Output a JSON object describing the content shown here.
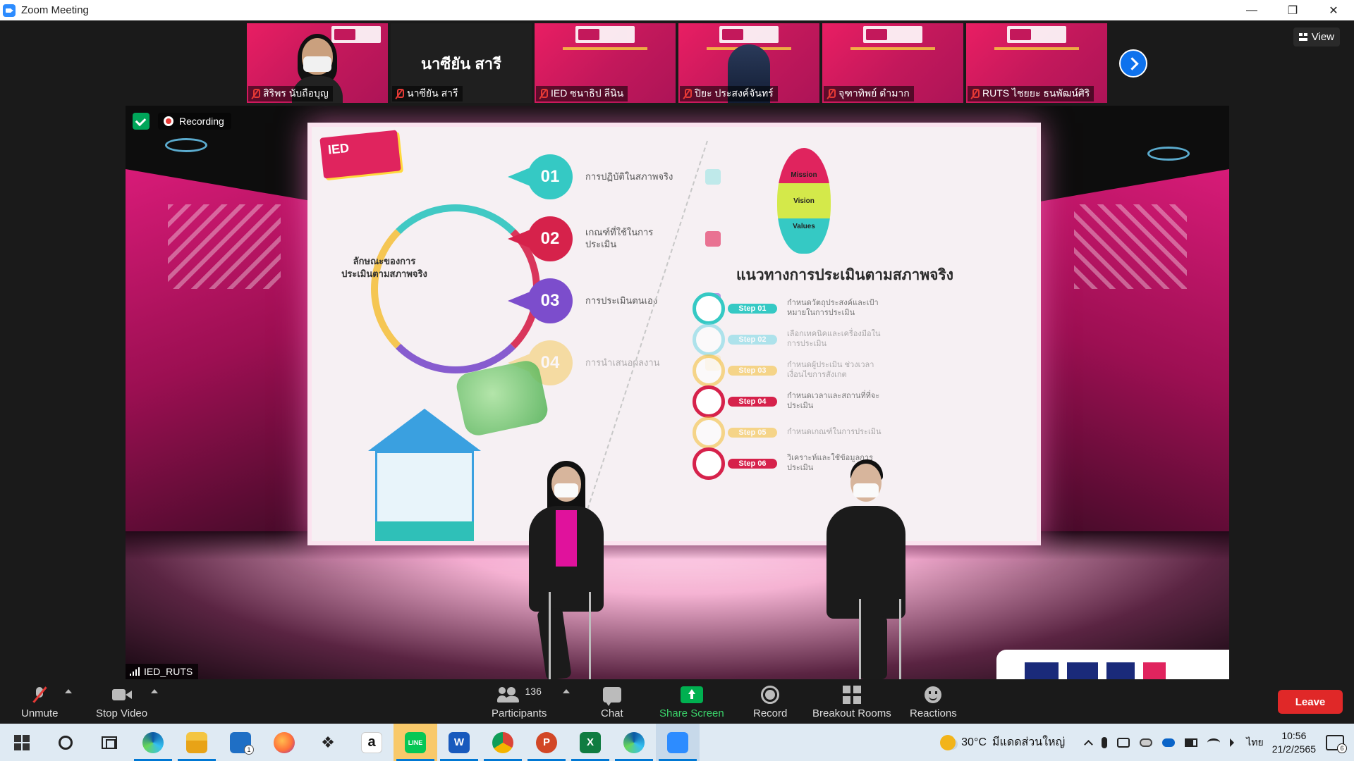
{
  "window": {
    "title": "Zoom Meeting",
    "minimize_glyph": "—",
    "restore_glyph": "❐",
    "close_glyph": "✕"
  },
  "gallery": {
    "tiles": [
      {
        "name": "สิริพร นับถือบุญ",
        "type": "camera"
      },
      {
        "name": "นาซียัน สารี",
        "type": "name-only",
        "display_name": "นาซียัน สารี"
      },
      {
        "name": "IED ซนาธิป ลีนิน",
        "type": "background"
      },
      {
        "name": "ปิยะ ประสงค์จันทร์",
        "type": "camera-dark"
      },
      {
        "name": "จุฑาทิพย์ ดำมาก",
        "type": "background"
      },
      {
        "name": "RUTS ไชยยะ ธนพัฒน์ศิริ",
        "type": "background"
      }
    ],
    "next_icon": "chevron-right-icon",
    "view_label": "View"
  },
  "video": {
    "recording_label": "Recording",
    "speaker_name": "IED_RUTS",
    "slide": {
      "logo_text": "IED",
      "steps": [
        {
          "num": "01",
          "color": "#35c9c4",
          "text": "การปฏิบัติในสภาพจริง"
        },
        {
          "num": "02",
          "color": "#d6224b",
          "text": "เกณฑ์ที่ใช้ในการประเมิน"
        },
        {
          "num": "03",
          "color": "#7c4dcc",
          "text": "การประเมินตนเอง"
        },
        {
          "num": "04",
          "color": "#f5c242",
          "text": "การนำเสนอผลงาน"
        }
      ],
      "center_text": "ลักษณะของการประเมินตามสภาพจริง",
      "balloon": [
        "Mission",
        "Vision",
        "Values"
      ],
      "heading": "แนวทางการประเมินตามสภาพจริง",
      "right_steps": [
        {
          "label": "Step 01",
          "color": "#35c9c4",
          "text": "กำหนดวัตถุประสงค์และเป้าหมายในการประเมิน"
        },
        {
          "label": "Step 02",
          "color": "#7ed9e6",
          "text": "เลือกเทคนิคและเครื่องมือในการประเมิน"
        },
        {
          "label": "Step 03",
          "color": "#f5c242",
          "text": "กำหนดผู้ประเมิน ช่วงเวลาเงื่อนไขการสังเกต"
        },
        {
          "label": "Step 04",
          "color": "#d6224b",
          "text": "กำหนดเวลาและสถานที่ที่จะประเมิน"
        },
        {
          "label": "Step 05",
          "color": "#f5c242",
          "text": "กำหนดเกณฑ์ในการประเมิน"
        },
        {
          "label": "Step 06",
          "color": "#d6224b",
          "text": "วิเคราะห์และใช้ข้อมูลการประเมิน"
        }
      ]
    }
  },
  "toolbar": {
    "unmute": "Unmute",
    "stop_video": "Stop Video",
    "participants": "Participants",
    "participants_count": "136",
    "chat": "Chat",
    "share_screen": "Share Screen",
    "record": "Record",
    "breakout_rooms": "Breakout Rooms",
    "reactions": "Reactions",
    "leave": "Leave"
  },
  "taskbar": {
    "apps": [
      {
        "name": "start-button",
        "kind": "start"
      },
      {
        "name": "search-button",
        "kind": "search"
      },
      {
        "name": "task-view-button",
        "kind": "taskview"
      },
      {
        "name": "edge-icon",
        "kind": "circ",
        "color": "#1e90d6"
      },
      {
        "name": "file-explorer-icon",
        "kind": "sq",
        "color": "#f4b400"
      },
      {
        "name": "mail-icon",
        "kind": "sq",
        "color": "#1f6fc5",
        "badge": "1"
      },
      {
        "name": "firefox-icon",
        "kind": "circ",
        "color": "#ff7139"
      },
      {
        "name": "dropbox-icon",
        "kind": "sq",
        "color": "#222"
      },
      {
        "name": "amazon-icon",
        "kind": "sq",
        "color": "#ffffff",
        "text": "a"
      },
      {
        "name": "line-icon",
        "kind": "sq",
        "color": "#06c755",
        "text": "LINE",
        "highlight": true
      },
      {
        "name": "word-icon",
        "kind": "sq",
        "color": "#185abd",
        "text": "W"
      },
      {
        "name": "chrome-icon",
        "kind": "circ",
        "color": "#db4437"
      },
      {
        "name": "powerpoint-icon",
        "kind": "circ",
        "color": "#d24726",
        "text": "P"
      },
      {
        "name": "excel-icon",
        "kind": "sq",
        "color": "#107c41",
        "text": "X"
      },
      {
        "name": "edge-dev-icon",
        "kind": "circ",
        "color": "#1e90d6"
      },
      {
        "name": "zoom-icon",
        "kind": "sq",
        "color": "#2d8cff",
        "active": true
      }
    ],
    "weather_temp": "30°C",
    "weather_text": "มีแดดส่วนใหญ่",
    "language": "ไทย",
    "time": "10:56",
    "date": "21/2/2565",
    "notification_count": "6"
  }
}
